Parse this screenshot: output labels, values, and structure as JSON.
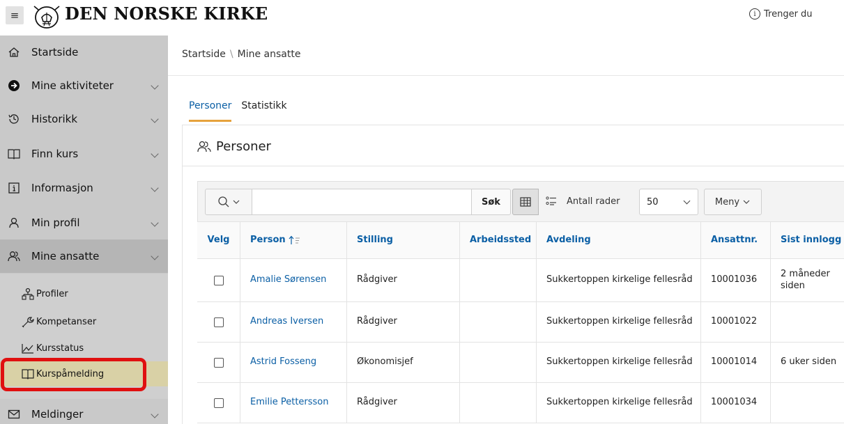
{
  "header": {
    "brand": "DEN NORSKE KIRKE",
    "help_text": "Trenger du"
  },
  "sidebar": {
    "items": [
      {
        "label": "Startside",
        "icon": "home-icon"
      },
      {
        "label": "Mine aktiviteter",
        "icon": "arrow-circle-icon"
      },
      {
        "label": "Historikk",
        "icon": "history-icon"
      },
      {
        "label": "Finn kurs",
        "icon": "book-icon"
      },
      {
        "label": "Informasjon",
        "icon": "info-icon"
      },
      {
        "label": "Min profil",
        "icon": "user-icon"
      },
      {
        "label": "Mine ansatte",
        "icon": "users-icon"
      },
      {
        "label": "Meldinger",
        "icon": "mail-icon"
      }
    ],
    "subitems": [
      {
        "label": "Profiler",
        "icon": "org-chart-icon"
      },
      {
        "label": "Kompetanser",
        "icon": "wrench-icon"
      },
      {
        "label": "Kursstatus",
        "icon": "line-chart-icon"
      },
      {
        "label": "Kurspåmelding",
        "icon": "book-icon"
      }
    ]
  },
  "breadcrumb": {
    "root": "Startside",
    "separator": "\\",
    "current": "Mine ansatte"
  },
  "tabs": [
    {
      "label": "Personer",
      "active": true
    },
    {
      "label": "Statistikk",
      "active": false
    }
  ],
  "panel": {
    "title": "Personer"
  },
  "toolbar": {
    "search_value": "",
    "search_button": "Søk",
    "rows_label": "Antall rader",
    "rows_value": "50",
    "menu_label": "Meny"
  },
  "table": {
    "columns": [
      "Velg",
      "Person",
      "Stilling",
      "Arbeidssted",
      "Avdeling",
      "Ansattnr.",
      "Sist innlogg"
    ],
    "rows": [
      {
        "person": "Amalie Sørensen",
        "stilling": "Rådgiver",
        "arbeidssted": "",
        "avdeling": "Sukkertoppen kirkelige fellesråd",
        "ansattnr": "10001036",
        "sist": "2 måneder siden"
      },
      {
        "person": "Andreas Iversen",
        "stilling": "Rådgiver",
        "arbeidssted": "",
        "avdeling": "Sukkertoppen kirkelige fellesråd",
        "ansattnr": "10001022",
        "sist": ""
      },
      {
        "person": "Astrid Fosseng",
        "stilling": "Økonomisjef",
        "arbeidssted": "",
        "avdeling": "Sukkertoppen kirkelige fellesråd",
        "ansattnr": "10001014",
        "sist": "6 uker siden"
      },
      {
        "person": "Emilie Pettersson",
        "stilling": "Rådgiver",
        "arbeidssted": "",
        "avdeling": "Sukkertoppen kirkelige fellesråd",
        "ansattnr": "10001034",
        "sist": ""
      }
    ]
  },
  "colors": {
    "sidebar_bg": "#c9c9c9",
    "highlight": "#d9d1a6",
    "link": "#0b5fa5",
    "tab_underline": "#e6a23c",
    "annotation_red": "#e01010"
  }
}
